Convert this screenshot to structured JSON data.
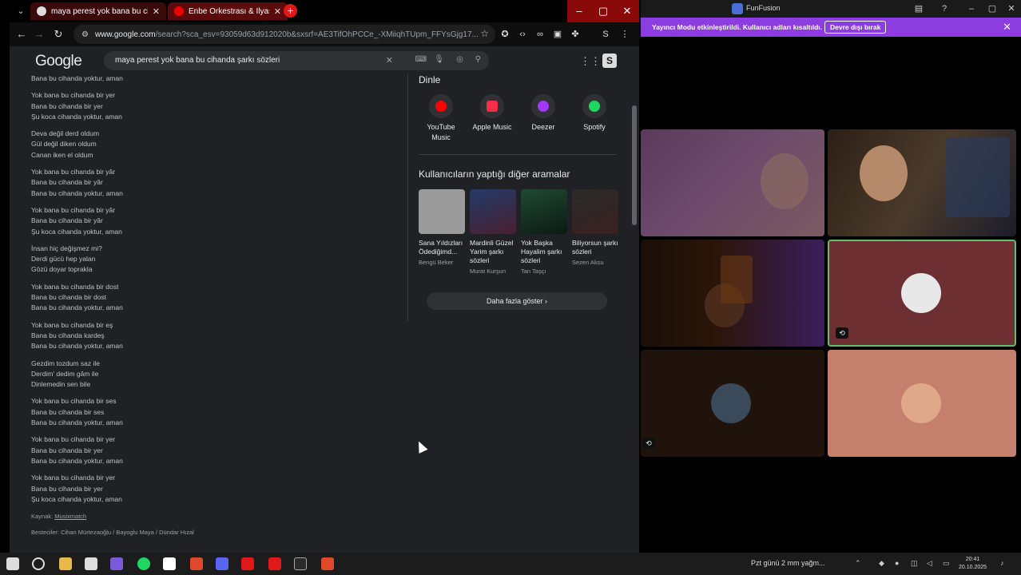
{
  "browser": {
    "tabs": [
      {
        "title": "maya perest yok bana bu cihan"
      },
      {
        "title": "Enbe Orkestrası & İlyas Yalçıntaş"
      }
    ],
    "url_host": "www.google.com",
    "url_rest": "/search?sca_esv=93059d63d912020b&sxsrf=AE3TifOhPCCe_-XMiiqhTUpm_FFYsGjg17...",
    "search_query": "maya perest yok bana bu cihanda şarkı sözleri",
    "google_logo": "Google"
  },
  "lyrics": [
    [
      "Bana bu cihanda yoktur, aman"
    ],
    [
      "Yok bana bu cihanda bir yer",
      "Bana bu cihanda bir yer",
      "Şu koca cihanda yoktur, aman"
    ],
    [
      "Deva değil derd oldum",
      "Gül değil diken oldum",
      "Canan iken el oldum"
    ],
    [
      "Yok bana bu cihanda bir yâr",
      "Bana bu cihanda bir yâr",
      "Bana bu cihanda yoktur, aman"
    ],
    [
      "Yok bana bu cihanda bir yâr",
      "Bana bu cihanda bir yâr",
      "Şu koca cihanda yoktur, aman"
    ],
    [
      "İnsan hiç değişmez mi?",
      "Derdi gücü hep yalan",
      "Gözü doyar toprakla"
    ],
    [
      "Yok bana bu cihanda bir dost",
      "Bana bu cihanda bir dost",
      "Bana bu cihanda yoktur, aman"
    ],
    [
      "Yok bana bu cihanda bir eş",
      "Bana bu cihanda kardeş",
      "Bana bu cihanda yoktur, aman"
    ],
    [
      "Gezdim tozdum saz ile",
      "Derdim' dedim gâm ile",
      "Dinlemedin sen bile"
    ],
    [
      "Yok bana bu cihanda bir ses",
      "Bana bu cihanda bir ses",
      "Bana bu cihanda yoktur, aman"
    ],
    [
      "Yok bana bu cihanda bir yer",
      "Bana bu cihanda bir yer",
      "Bana bu cihanda yoktur, aman"
    ],
    [
      "Yok bana bu cihanda bir yer",
      "Bana bu cihanda bir yer",
      "Şu koca cihanda yoktur, aman"
    ]
  ],
  "source": {
    "label": "Kaynak:",
    "link": "Musixmatch"
  },
  "writers": "Besteciler: Cihan Mürtezaoğlu / Bayoglu Maya / Dündar Hızal",
  "listen": {
    "title": "Dinle",
    "services": [
      {
        "label": "YouTube Music",
        "color": "#ff0000"
      },
      {
        "label": "Apple Music",
        "color": "#fa2d48"
      },
      {
        "label": "Deezer",
        "color": "#a238ff"
      },
      {
        "label": "Spotify",
        "color": "#1ed760"
      }
    ]
  },
  "others": {
    "title": "Kullanıcıların yaptığı diğer aramalar",
    "cards": [
      {
        "title": "Sana Yıldızları Ödediğimd...",
        "sub": "Bengü Beker",
        "color": "#9a9a9a"
      },
      {
        "title": "Mardinli Güzel Yarim şarkı sözleri",
        "sub": "Murat Kurşun",
        "color": "#3a2a4a"
      },
      {
        "title": "Yok Başka Hayalim şarkı sözleri",
        "sub": "Tan Taşçı",
        "color": "#1f4a34"
      },
      {
        "title": "Biliyorsun şarkı sözleri",
        "sub": "Sezen Aksu",
        "color": "#2a2a2a"
      }
    ],
    "more": "Daha fazla göster"
  },
  "funfusion": {
    "title": "FunFusion",
    "banner": "Yayıncı Modu etkinleştirildi. Kullanıcı adları kısaltıldı.",
    "banner_button": "Devre dışı bırak"
  },
  "taskbar": {
    "weather": "Pzt günü 2 mm yağm...",
    "time": "20:41",
    "date": "20.10.2025"
  }
}
